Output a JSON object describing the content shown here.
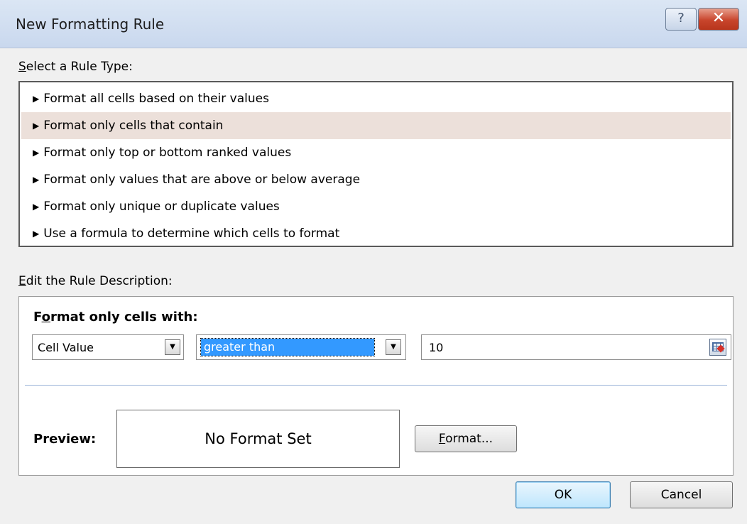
{
  "window": {
    "title": "New Formatting Rule",
    "help_label": "?",
    "close_label": "✕"
  },
  "rule_type": {
    "label_prefix": "S",
    "label_rest": "elect a Rule Type:",
    "items": [
      {
        "label": "Format all cells based on their values",
        "selected": false
      },
      {
        "label": "Format only cells that contain",
        "selected": true
      },
      {
        "label": "Format only top or bottom ranked values",
        "selected": false
      },
      {
        "label": "Format only values that are above or below average",
        "selected": false
      },
      {
        "label": "Format only unique or duplicate values",
        "selected": false
      },
      {
        "label": "Use a formula to determine which cells to format",
        "selected": false
      }
    ]
  },
  "description": {
    "label_prefix": "E",
    "label_rest": "dit the Rule Description:",
    "heading_prefix": "F",
    "heading_mnemonic": "o",
    "heading_rest": "rmat only cells with:",
    "condition_field": "Cell Value",
    "operator": "greater than",
    "value": "10",
    "preview_label": "Preview:",
    "preview_text": "No Format Set",
    "format_button_mnemonic": "F",
    "format_button_rest": "ormat..."
  },
  "footer": {
    "ok_label": "OK",
    "cancel_label": "Cancel"
  },
  "colors": {
    "selected_item": "#ece0da",
    "highlight": "#3399ff",
    "close_button": "#c8452c"
  }
}
